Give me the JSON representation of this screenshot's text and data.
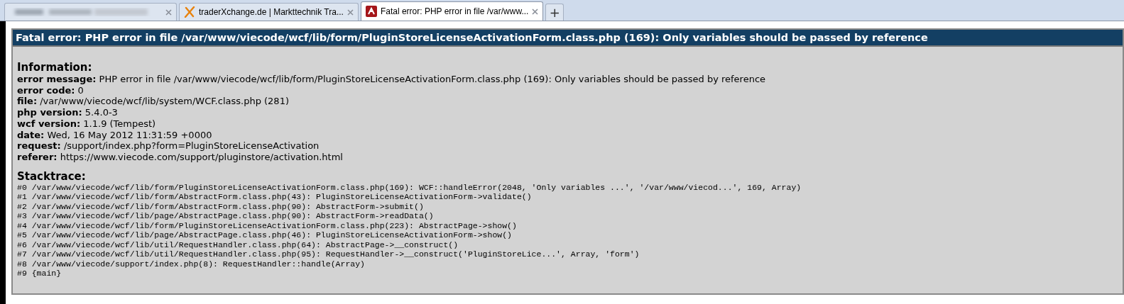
{
  "tabs": [
    {
      "kind": "blurred",
      "selected": false
    },
    {
      "kind": "cross-logo",
      "label": "traderXchange.de | Markttechnik Tra...",
      "selected": false
    },
    {
      "kind": "red-logo",
      "label": "Fatal error: PHP error in file /var/www...",
      "selected": true
    }
  ],
  "new_tab": "+",
  "error": {
    "title": "Fatal error: PHP error in file /var/www/viecode/wcf/lib/form/PluginStoreLicenseActivationForm.class.php (169): Only variables should be passed by reference",
    "info_heading": "Information:",
    "info": [
      {
        "label": "error message:",
        "value": "PHP error in file /var/www/viecode/wcf/lib/form/PluginStoreLicenseActivationForm.class.php (169): Only variables should be passed by reference"
      },
      {
        "label": "error code:",
        "value": "0"
      },
      {
        "label": "file:",
        "value": "/var/www/viecode/wcf/lib/system/WCF.class.php (281)"
      },
      {
        "label": "php version:",
        "value": "5.4.0-3"
      },
      {
        "label": "wcf version:",
        "value": "1.1.9 (Tempest)"
      },
      {
        "label": "date:",
        "value": "Wed, 16 May 2012 11:31:59 +0000"
      },
      {
        "label": "request:",
        "value": "/support/index.php?form=PluginStoreLicenseActivation"
      },
      {
        "label": "referer:",
        "value": "https://www.viecode.com/support/pluginstore/activation.html"
      }
    ],
    "stack_heading": "Stacktrace:",
    "stacktrace": [
      "#0 /var/www/viecode/wcf/lib/form/PluginStoreLicenseActivationForm.class.php(169): WCF::handleError(2048, 'Only variables ...', '/var/www/viecod...', 169, Array)",
      "#1 /var/www/viecode/wcf/lib/form/AbstractForm.class.php(43): PluginStoreLicenseActivationForm->validate()",
      "#2 /var/www/viecode/wcf/lib/form/AbstractForm.class.php(90): AbstractForm->submit()",
      "#3 /var/www/viecode/wcf/lib/page/AbstractPage.class.php(90): AbstractForm->readData()",
      "#4 /var/www/viecode/wcf/lib/form/PluginStoreLicenseActivationForm.class.php(223): AbstractPage->show()",
      "#5 /var/www/viecode/wcf/lib/page/AbstractPage.class.php(46): PluginStoreLicenseActivationForm->show()",
      "#6 /var/www/viecode/wcf/lib/util/RequestHandler.class.php(64): AbstractPage->__construct()",
      "#7 /var/www/viecode/wcf/lib/util/RequestHandler.class.php(95): RequestHandler->__construct('PluginStoreLice...', Array, 'form')",
      "#8 /var/www/viecode/support/index.php(8): RequestHandler::handle(Array)",
      "#9 {main}"
    ]
  }
}
